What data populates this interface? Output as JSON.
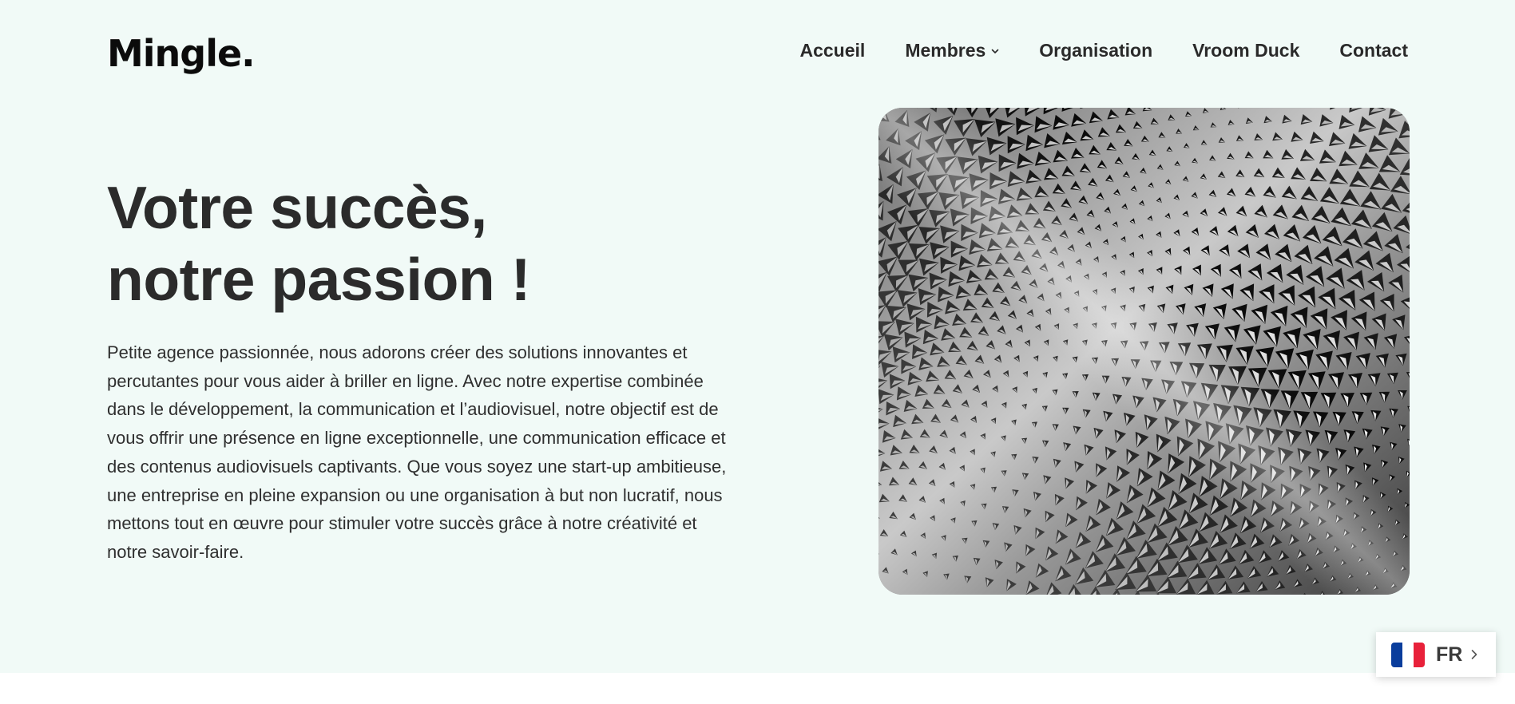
{
  "header": {
    "logo": "Mingle."
  },
  "nav": {
    "items": [
      {
        "label": "Accueil"
      },
      {
        "label": "Membres",
        "has_dropdown": true
      },
      {
        "label": "Organisation"
      },
      {
        "label": "Vroom Duck"
      },
      {
        "label": "Contact"
      }
    ]
  },
  "hero": {
    "title_line1": "Votre succès,",
    "title_line2": "notre passion !",
    "description": "Petite agence passionnée, nous adorons créer des solutions innovantes et percutantes pour vous aider à briller en ligne. Avec notre expertise combinée dans le développement, la communication et l’audiovisuel, notre objectif est de vous offrir une présence en ligne exceptionnelle, une communication efficace et des contenus audiovisuels captivants. Que vous soyez une start-up ambitieuse, une entreprise en pleine expansion ou une organisation à but non lucratif, nous mettons tout en œuvre pour stimuler votre succès grâce à notre créativité et notre savoir-faire.",
    "image": "abstract-architecture-facade-photo"
  },
  "language": {
    "code": "FR",
    "flag": "france-flag-icon",
    "flag_colors": [
      "#0a3d9c",
      "#ffffff",
      "#e8213a"
    ]
  },
  "colors": {
    "hero_background": "#f1faf7",
    "text": "#2b2b2b",
    "logo": "#0b0b0b"
  }
}
